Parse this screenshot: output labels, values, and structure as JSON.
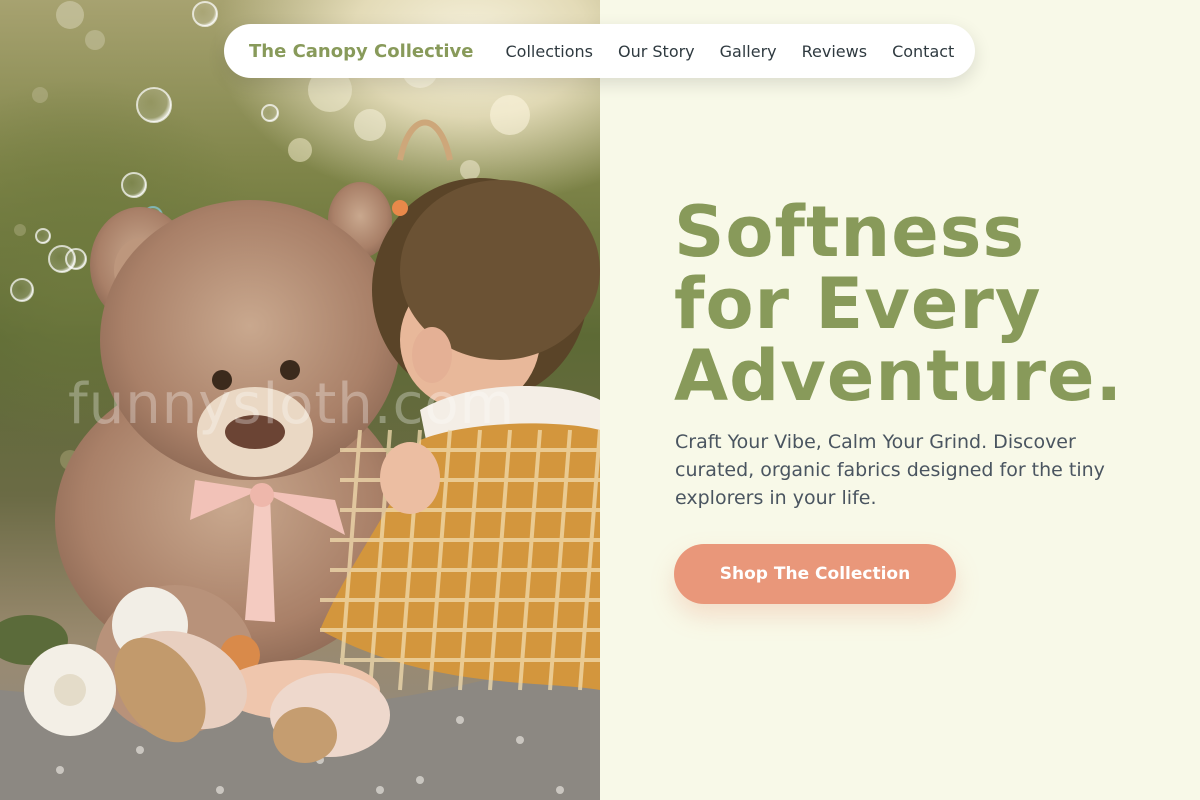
{
  "nav": {
    "brand": "The Canopy Collective",
    "links": [
      "Collections",
      "Our Story",
      "Gallery",
      "Reviews",
      "Contact"
    ]
  },
  "hero": {
    "headline_lines": [
      "Softness",
      "for Every",
      "Adventure."
    ],
    "subtext": "Craft Your Vibe, Calm Your Grind. Discover curated, organic fabrics designed for the tiny explorers in your life.",
    "cta_label": "Shop The Collection"
  },
  "photo": {
    "watermark": "funnysloth.com"
  },
  "colors": {
    "brand_green": "#889a5a",
    "accent_coral": "#e9977a",
    "background_cream": "#f8f9e8",
    "body_text": "#4a5560"
  }
}
